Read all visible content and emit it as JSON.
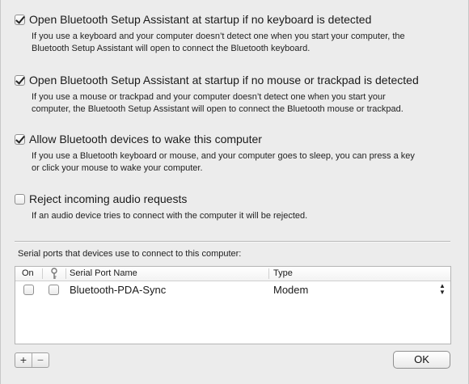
{
  "options": [
    {
      "checked": true,
      "label": "Open Bluetooth Setup Assistant at startup if no keyboard is detected",
      "description_lines": [
        "If you use a keyboard and your computer doesn’t detect one when you start your computer, the",
        "Bluetooth Setup Assistant will open to connect the Bluetooth keyboard."
      ]
    },
    {
      "checked": true,
      "label": "Open Bluetooth Setup Assistant at startup if no mouse or trackpad is detected",
      "description_lines": [
        "If you use a mouse or trackpad and your computer doesn’t detect one when you start your",
        "computer, the Bluetooth Setup Assistant will open to connect the Bluetooth mouse or trackpad."
      ]
    },
    {
      "checked": true,
      "label": "Allow Bluetooth devices to wake this computer",
      "description_lines": [
        "If you use a Bluetooth keyboard or mouse, and your computer goes to sleep, you can press a key",
        "or click your mouse to wake your computer."
      ]
    },
    {
      "checked": false,
      "label": "Reject incoming audio requests",
      "description_lines": [
        "If an audio device tries to connect with the computer it will be rejected."
      ]
    }
  ],
  "serial_ports": {
    "caption": "Serial ports that devices use to connect to this computer:",
    "columns": {
      "on": "On",
      "key_icon": "key-icon",
      "name": "Serial Port Name",
      "type": "Type"
    },
    "rows": [
      {
        "on": false,
        "secure": false,
        "name": "Bluetooth-PDA-Sync",
        "type": "Modem"
      }
    ]
  },
  "footer": {
    "add_label": "+",
    "remove_label": "−",
    "ok_label": "OK"
  }
}
